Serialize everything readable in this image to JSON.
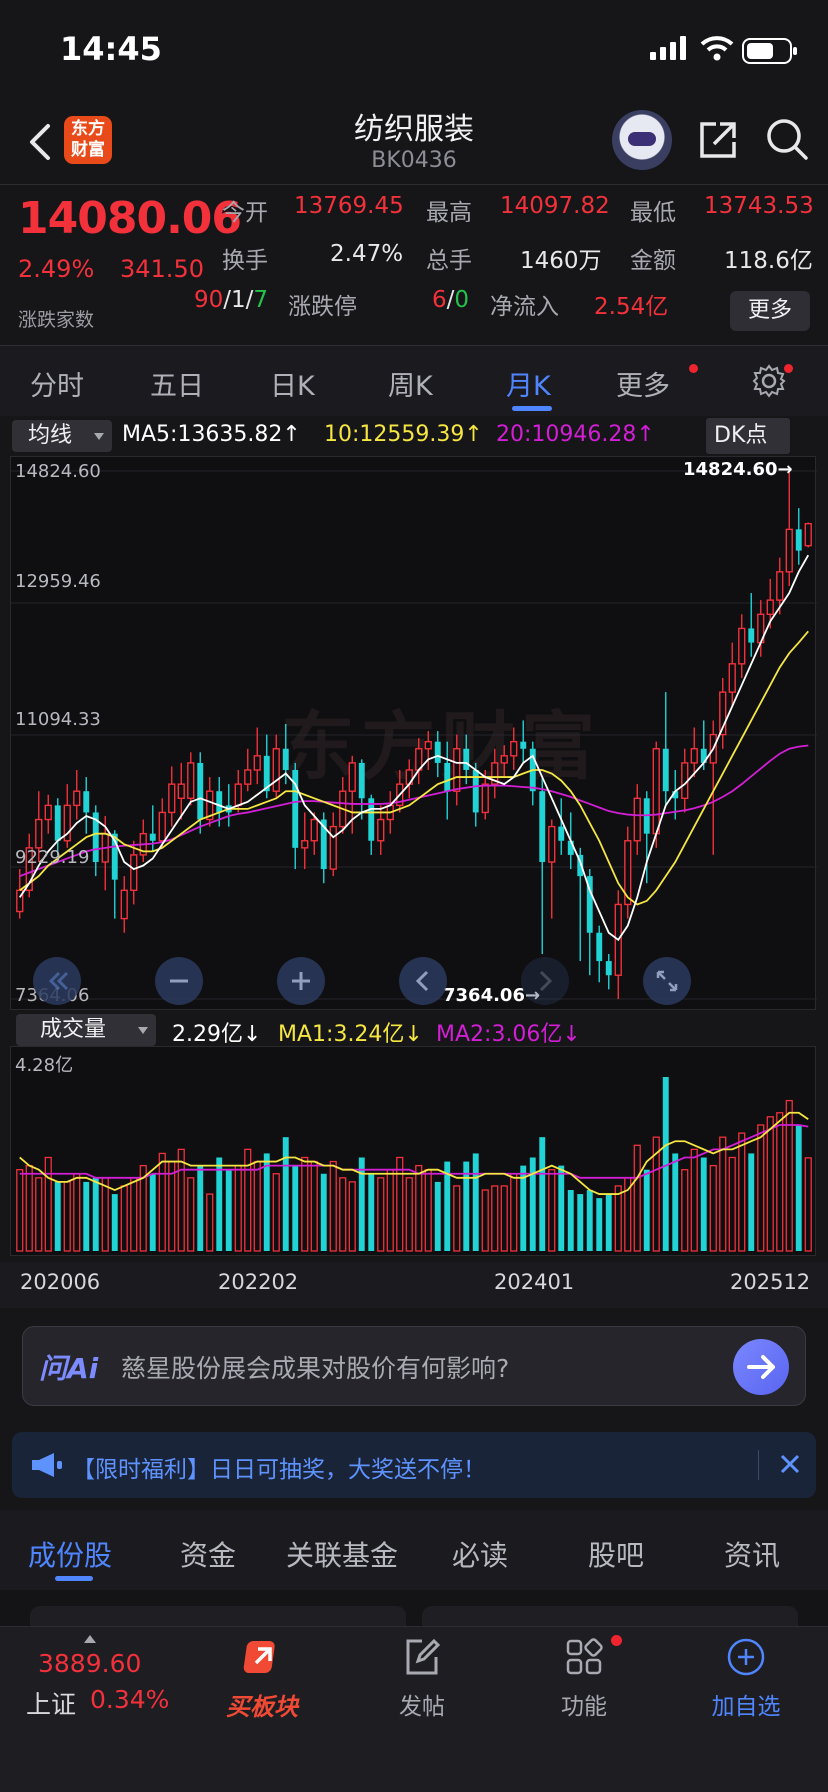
{
  "status_bar": {
    "time": "14:45"
  },
  "header": {
    "title": "纺织服装",
    "code": "BK0436",
    "logo_text_line1": "东方",
    "logo_text_line2": "财富"
  },
  "quote": {
    "price": "14080.06",
    "change_pct": "2.49%",
    "change": "341.50",
    "advance_decline_label": "涨跌家数",
    "advance": "90",
    "flat": "1",
    "decline": "7",
    "open_label": "今开",
    "open": "13769.45",
    "high_label": "最高",
    "high": "14097.82",
    "low_label": "最低",
    "low": "13743.53",
    "turnover_label": "换手",
    "turnover": "2.47%",
    "volume_label": "总手",
    "volume": "1460万",
    "amount_label": "金额",
    "amount": "118.6亿",
    "limit_label": "涨跌停",
    "limit_up": "6",
    "limit_down": "0",
    "netflow_label": "净流入",
    "netflow": "2.54亿",
    "more_label": "更多",
    "separator": "/"
  },
  "period_tabs": {
    "items": [
      "分时",
      "五日",
      "日K",
      "周K",
      "月K",
      "更多"
    ],
    "active": "月K"
  },
  "ma_legend": {
    "selector": "均线",
    "ma5": "MA5:13635.82↑",
    "ma10": "10:12559.39↑",
    "ma20": "20:10946.28↑",
    "dk_button": "DK点"
  },
  "kline": {
    "y_labels": [
      "14824.60",
      "12959.46",
      "11094.33",
      "9229.19",
      "7364.06"
    ],
    "max_marker": "14824.60→",
    "min_marker": "7364.06→",
    "watermark": "东方财富"
  },
  "volume_legend": {
    "selector": "成交量",
    "vol": "2.29亿↓",
    "ma1": "MA1:3.24亿↓",
    "ma2": "MA2:3.06亿↓",
    "y_max": "4.28亿"
  },
  "date_labels": [
    "202006",
    "202202",
    "202401",
    "202512"
  ],
  "colors": {
    "up": "#f2313b",
    "down": "#22d3d6",
    "ma5": "#ffffff",
    "ma10": "#f5e642",
    "ma20": "#d21fd6",
    "accent": "#4f86ff"
  },
  "chart_data": {
    "type": "candlestick",
    "period": "monthly",
    "ylim": [
      7364.06,
      14824.6
    ],
    "candles": [
      {
        "o": 8600,
        "c": 8900,
        "h": 9200,
        "l": 8500,
        "up": true
      },
      {
        "o": 8900,
        "c": 9500,
        "h": 9700,
        "l": 8800,
        "up": true
      },
      {
        "o": 9500,
        "c": 9900,
        "h": 10300,
        "l": 9300,
        "up": true
      },
      {
        "o": 9900,
        "c": 10100,
        "h": 10250,
        "l": 9700,
        "up": true
      },
      {
        "o": 10100,
        "c": 9600,
        "h": 10200,
        "l": 9400,
        "up": false
      },
      {
        "o": 9600,
        "c": 10100,
        "h": 10400,
        "l": 9500,
        "up": true
      },
      {
        "o": 10100,
        "c": 10300,
        "h": 10600,
        "l": 9900,
        "up": true
      },
      {
        "o": 10300,
        "c": 10000,
        "h": 10500,
        "l": 9700,
        "up": false
      },
      {
        "o": 10000,
        "c": 9300,
        "h": 10100,
        "l": 9100,
        "up": false
      },
      {
        "o": 9300,
        "c": 9700,
        "h": 9950,
        "l": 8900,
        "up": true
      },
      {
        "o": 9700,
        "c": 9050,
        "h": 9750,
        "l": 8500,
        "up": false
      },
      {
        "o": 8500,
        "c": 8900,
        "h": 9100,
        "l": 8300,
        "up": true
      },
      {
        "o": 8900,
        "c": 9400,
        "h": 9600,
        "l": 8700,
        "up": true
      },
      {
        "o": 9400,
        "c": 9700,
        "h": 9900,
        "l": 9300,
        "up": true
      },
      {
        "o": 9700,
        "c": 9600,
        "h": 10100,
        "l": 9450,
        "up": false
      },
      {
        "o": 9600,
        "c": 10000,
        "h": 10200,
        "l": 9500,
        "up": true
      },
      {
        "o": 10000,
        "c": 10400,
        "h": 10650,
        "l": 9800,
        "up": true
      },
      {
        "o": 10400,
        "c": 10200,
        "h": 10700,
        "l": 9900,
        "up": true
      },
      {
        "o": 10200,
        "c": 10700,
        "h": 10850,
        "l": 10100,
        "up": true
      },
      {
        "o": 10700,
        "c": 9900,
        "h": 10850,
        "l": 9700,
        "up": false
      },
      {
        "o": 9900,
        "c": 10300,
        "h": 10500,
        "l": 9800,
        "up": true
      },
      {
        "o": 10300,
        "c": 10000,
        "h": 10500,
        "l": 9800,
        "up": false
      },
      {
        "o": 10000,
        "c": 10100,
        "h": 10400,
        "l": 9800,
        "up": false
      },
      {
        "o": 10100,
        "c": 10400,
        "h": 10600,
        "l": 10000,
        "up": true
      },
      {
        "o": 10400,
        "c": 10600,
        "h": 10900,
        "l": 10300,
        "up": true
      },
      {
        "o": 10600,
        "c": 10800,
        "h": 11200,
        "l": 10400,
        "up": true
      },
      {
        "o": 10800,
        "c": 10300,
        "h": 11100,
        "l": 10200,
        "up": false
      },
      {
        "o": 10300,
        "c": 10900,
        "h": 11100,
        "l": 10200,
        "up": true
      },
      {
        "o": 10900,
        "c": 10600,
        "h": 11250,
        "l": 10400,
        "up": false
      },
      {
        "o": 10600,
        "c": 9500,
        "h": 10700,
        "l": 9200,
        "up": false
      },
      {
        "o": 9500,
        "c": 9600,
        "h": 10000,
        "l": 9200,
        "up": true
      },
      {
        "o": 9600,
        "c": 9900,
        "h": 10000,
        "l": 9400,
        "up": true
      },
      {
        "o": 9900,
        "c": 9200,
        "h": 10000,
        "l": 9000,
        "up": false
      },
      {
        "o": 9200,
        "c": 9800,
        "h": 10000,
        "l": 9100,
        "up": true
      },
      {
        "o": 9800,
        "c": 10300,
        "h": 10500,
        "l": 9700,
        "up": true
      },
      {
        "o": 10300,
        "c": 10700,
        "h": 10800,
        "l": 9700,
        "up": true
      },
      {
        "o": 10700,
        "c": 10200,
        "h": 10750,
        "l": 9900,
        "up": false
      },
      {
        "o": 10200,
        "c": 9600,
        "h": 10250,
        "l": 9400,
        "up": false
      },
      {
        "o": 9600,
        "c": 9900,
        "h": 10100,
        "l": 9400,
        "up": true
      },
      {
        "o": 9900,
        "c": 10100,
        "h": 10300,
        "l": 9700,
        "up": true
      },
      {
        "o": 10100,
        "c": 10400,
        "h": 10600,
        "l": 10000,
        "up": true
      },
      {
        "o": 10400,
        "c": 10600,
        "h": 10750,
        "l": 10200,
        "up": true
      },
      {
        "o": 10600,
        "c": 10900,
        "h": 11050,
        "l": 10400,
        "up": true
      },
      {
        "o": 10900,
        "c": 11000,
        "h": 11150,
        "l": 10600,
        "up": true
      },
      {
        "o": 11000,
        "c": 10700,
        "h": 11150,
        "l": 10500,
        "up": false
      },
      {
        "o": 10700,
        "c": 10300,
        "h": 11000,
        "l": 9900,
        "up": false
      },
      {
        "o": 10300,
        "c": 10900,
        "h": 11100,
        "l": 10100,
        "up": true
      },
      {
        "o": 10900,
        "c": 10600,
        "h": 11100,
        "l": 10400,
        "up": false
      },
      {
        "o": 10600,
        "c": 10000,
        "h": 10700,
        "l": 9800,
        "up": false
      },
      {
        "o": 10000,
        "c": 10400,
        "h": 10600,
        "l": 9900,
        "up": true
      },
      {
        "o": 10400,
        "c": 10700,
        "h": 10900,
        "l": 10200,
        "up": true
      },
      {
        "o": 10700,
        "c": 10800,
        "h": 10950,
        "l": 10500,
        "up": true
      },
      {
        "o": 10800,
        "c": 11000,
        "h": 11200,
        "l": 10600,
        "up": true
      },
      {
        "o": 11000,
        "c": 10900,
        "h": 11300,
        "l": 10700,
        "up": false
      },
      {
        "o": 10900,
        "c": 10300,
        "h": 11000,
        "l": 10100,
        "up": false
      },
      {
        "o": 10300,
        "c": 9300,
        "h": 10500,
        "l": 8000,
        "up": false
      },
      {
        "o": 9300,
        "c": 9800,
        "h": 9900,
        "l": 8500,
        "up": true
      },
      {
        "o": 9800,
        "c": 9600,
        "h": 10200,
        "l": 9400,
        "up": false
      },
      {
        "o": 9600,
        "c": 9400,
        "h": 10000,
        "l": 9200,
        "up": false
      },
      {
        "o": 9400,
        "c": 9100,
        "h": 9500,
        "l": 7900,
        "up": false
      },
      {
        "o": 9100,
        "c": 8300,
        "h": 9200,
        "l": 7700,
        "up": false
      },
      {
        "o": 8300,
        "c": 7900,
        "h": 8400,
        "l": 7600,
        "up": false
      },
      {
        "o": 7900,
        "c": 7700,
        "h": 8000,
        "l": 7500,
        "up": false
      },
      {
        "o": 7700,
        "c": 8700,
        "h": 8900,
        "l": 7364.06,
        "up": true
      },
      {
        "o": 8700,
        "c": 9600,
        "h": 9800,
        "l": 8500,
        "up": true
      },
      {
        "o": 9600,
        "c": 10200,
        "h": 10400,
        "l": 9400,
        "up": true
      },
      {
        "o": 10200,
        "c": 9700,
        "h": 10300,
        "l": 9000,
        "up": false
      },
      {
        "o": 9700,
        "c": 10900,
        "h": 11000,
        "l": 9500,
        "up": true
      },
      {
        "o": 10900,
        "c": 10300,
        "h": 11700,
        "l": 10100,
        "up": false
      },
      {
        "o": 10300,
        "c": 10200,
        "h": 10600,
        "l": 9900,
        "up": false
      },
      {
        "o": 10200,
        "c": 10700,
        "h": 10900,
        "l": 10000,
        "up": true
      },
      {
        "o": 10700,
        "c": 10900,
        "h": 11200,
        "l": 10500,
        "up": true
      },
      {
        "o": 10900,
        "c": 10700,
        "h": 11300,
        "l": 10600,
        "up": false
      },
      {
        "o": 10700,
        "c": 11100,
        "h": 11300,
        "l": 9400,
        "up": true
      },
      {
        "o": 11100,
        "c": 11700,
        "h": 11900,
        "l": 10900,
        "up": true
      },
      {
        "o": 11700,
        "c": 12100,
        "h": 12400,
        "l": 11500,
        "up": true
      },
      {
        "o": 12100,
        "c": 12600,
        "h": 12800,
        "l": 11900,
        "up": true
      },
      {
        "o": 12600,
        "c": 12400,
        "h": 13100,
        "l": 12200,
        "up": false
      },
      {
        "o": 12400,
        "c": 12800,
        "h": 13000,
        "l": 12200,
        "up": true
      },
      {
        "o": 12800,
        "c": 13000,
        "h": 13300,
        "l": 12600,
        "up": true
      },
      {
        "o": 13000,
        "c": 13400,
        "h": 13600,
        "l": 12800,
        "up": true
      },
      {
        "o": 13400,
        "c": 14000,
        "h": 14824.6,
        "l": 13200,
        "up": true
      },
      {
        "o": 14000,
        "c": 13700,
        "h": 14300,
        "l": 13500,
        "up": false
      },
      {
        "o": 13769.45,
        "c": 14080.06,
        "h": 14097.82,
        "l": 13743.53,
        "up": true
      }
    ],
    "ma5": [
      8800,
      9000,
      9250,
      9450,
      9600,
      9700,
      9850,
      9950,
      9900,
      9800,
      9600,
      9300,
      9200,
      9250,
      9350,
      9550,
      9750,
      9950,
      10150,
      10200,
      10150,
      10100,
      10050,
      10100,
      10150,
      10250,
      10350,
      10450,
      10550,
      10400,
      10100,
      9950,
      9800,
      9650,
      9750,
      9900,
      10000,
      10050,
      10050,
      10100,
      10250,
      10400,
      10600,
      10750,
      10800,
      10750,
      10700,
      10700,
      10600,
      10500,
      10450,
      10400,
      10500,
      10700,
      10800,
      10500,
      10200,
      9900,
      9600,
      9300,
      8900,
      8600,
      8300,
      8200,
      8400,
      8800,
      9300,
      9700,
      10100,
      10300,
      10400,
      10550,
      10700,
      10900,
      11200,
      11500,
      11800,
      12100,
      12400,
      12700,
      12900,
      13100,
      13400,
      13635.82
    ],
    "ma10": [
      8900,
      9000,
      9100,
      9250,
      9350,
      9450,
      9550,
      9650,
      9700,
      9700,
      9650,
      9550,
      9500,
      9450,
      9450,
      9500,
      9600,
      9700,
      9800,
      9900,
      9950,
      10000,
      10050,
      10050,
      10050,
      10100,
      10150,
      10200,
      10300,
      10300,
      10250,
      10200,
      10150,
      10100,
      10050,
      10000,
      10000,
      10000,
      10000,
      10000,
      10050,
      10100,
      10200,
      10300,
      10400,
      10450,
      10500,
      10500,
      10500,
      10500,
      10500,
      10500,
      10500,
      10550,
      10600,
      10600,
      10550,
      10450,
      10300,
      10100,
      9850,
      9600,
      9300,
      9000,
      8800,
      8700,
      8750,
      8900,
      9100,
      9300,
      9550,
      9800,
      10050,
      10300,
      10550,
      10800,
      11050,
      11300,
      11550,
      11800,
      12050,
      12250,
      12400,
      12559.39
    ],
    "ma20": [
      9100,
      9150,
      9200,
      9250,
      9300,
      9350,
      9400,
      9450,
      9480,
      9500,
      9520,
      9530,
      9540,
      9550,
      9560,
      9580,
      9620,
      9680,
      9740,
      9800,
      9850,
      9900,
      9950,
      9980,
      10000,
      10030,
      10060,
      10090,
      10120,
      10150,
      10160,
      10160,
      10150,
      10140,
      10130,
      10120,
      10120,
      10120,
      10120,
      10130,
      10150,
      10180,
      10210,
      10240,
      10270,
      10300,
      10330,
      10350,
      10370,
      10380,
      10380,
      10380,
      10370,
      10360,
      10350,
      10330,
      10300,
      10260,
      10220,
      10170,
      10120,
      10070,
      10020,
      9990,
      9970,
      9960,
      9960,
      9970,
      9990,
      10010,
      10030,
      10060,
      10100,
      10150,
      10220,
      10300,
      10400,
      10510,
      10620,
      10730,
      10830,
      10900,
      10930,
      10946.28
    ],
    "volume_ylim": [
      0,
      4.28
    ],
    "volume": [
      2.0,
      2.1,
      1.8,
      2.3,
      1.7,
      1.7,
      1.9,
      1.7,
      1.8,
      1.8,
      1.4,
      1.6,
      1.8,
      2.1,
      1.9,
      2.4,
      2.2,
      2.5,
      1.8,
      2.1,
      1.4,
      2.3,
      2.0,
      2.1,
      2.5,
      2.2,
      2.4,
      1.9,
      2.8,
      2.1,
      2.3,
      2.2,
      1.9,
      2.2,
      1.8,
      1.7,
      2.3,
      1.9,
      1.8,
      2.0,
      2.3,
      1.8,
      2.1,
      2.0,
      1.7,
      2.2,
      1.6,
      2.2,
      2.4,
      1.5,
      1.6,
      1.6,
      1.9,
      2.1,
      2.3,
      2.8,
      2.0,
      2.1,
      1.5,
      1.4,
      1.5,
      1.3,
      1.4,
      1.6,
      1.8,
      2.6,
      2.0,
      2.8,
      4.28,
      2.4,
      2.0,
      2.5,
      2.3,
      2.1,
      2.8,
      2.3,
      2.9,
      2.4,
      3.1,
      3.3,
      3.4,
      3.7,
      3.1,
      2.29
    ],
    "vol_ma1": [
      2.3,
      2.1,
      2.0,
      1.8,
      1.7,
      1.7,
      1.8,
      1.8,
      1.7,
      1.6,
      1.5,
      1.6,
      1.7,
      1.8,
      2.0,
      2.2,
      2.2,
      2.2,
      2.1,
      2.1,
      2.1,
      2.1,
      2.1,
      2.1,
      2.1,
      2.2,
      2.2,
      2.2,
      2.3,
      2.3,
      2.2,
      2.2,
      2.1,
      2.1,
      2.0,
      2.0,
      1.9,
      1.9,
      1.9,
      1.9,
      1.9,
      1.9,
      1.9,
      2.0,
      2.0,
      1.9,
      1.8,
      1.8,
      1.8,
      1.9,
      1.9,
      1.9,
      1.8,
      1.8,
      1.9,
      2.0,
      2.1,
      2.0,
      1.9,
      1.7,
      1.5,
      1.4,
      1.4,
      1.4,
      1.5,
      1.8,
      2.2,
      2.4,
      2.6,
      2.7,
      2.7,
      2.6,
      2.5,
      2.4,
      2.5,
      2.5,
      2.6,
      2.7,
      2.8,
      3.0,
      3.2,
      3.4,
      3.4,
      3.24
    ],
    "vol_ma2": [
      1.9,
      1.9,
      1.9,
      1.9,
      1.9,
      1.9,
      1.9,
      1.9,
      1.8,
      1.8,
      1.8,
      1.8,
      1.8,
      1.8,
      1.9,
      1.9,
      1.9,
      2.0,
      2.0,
      2.0,
      2.0,
      2.0,
      2.0,
      2.0,
      2.0,
      2.0,
      2.1,
      2.1,
      2.1,
      2.1,
      2.1,
      2.1,
      2.1,
      2.1,
      2.0,
      2.0,
      2.0,
      2.0,
      2.0,
      2.0,
      2.0,
      2.0,
      1.9,
      1.9,
      1.9,
      1.9,
      1.9,
      1.9,
      1.9,
      1.9,
      1.9,
      1.9,
      1.9,
      1.9,
      1.9,
      1.9,
      1.9,
      1.9,
      1.9,
      1.8,
      1.8,
      1.8,
      1.8,
      1.8,
      1.8,
      1.8,
      1.9,
      2.0,
      2.1,
      2.2,
      2.3,
      2.3,
      2.4,
      2.5,
      2.5,
      2.6,
      2.7,
      2.8,
      2.9,
      3.0,
      3.1,
      3.1,
      3.1,
      3.06
    ],
    "x_labels": [
      "202006",
      "202202",
      "202401",
      "202512"
    ]
  },
  "ai_bar": {
    "logo": "问Ai",
    "question": "慈星股份展会成果对股价有何影响?"
  },
  "promo": {
    "text": "【限时福利】日日可抽奖，大奖送不停！"
  },
  "sub_tabs": {
    "items": [
      "成份股",
      "资金",
      "关联基金",
      "必读",
      "股吧",
      "资讯"
    ],
    "active": "成份股"
  },
  "bottom_nav": {
    "index_price": "3889.60",
    "index_name": "上证",
    "index_pct": "0.34%",
    "items": [
      "买板块",
      "发帖",
      "功能",
      "加自选"
    ]
  }
}
